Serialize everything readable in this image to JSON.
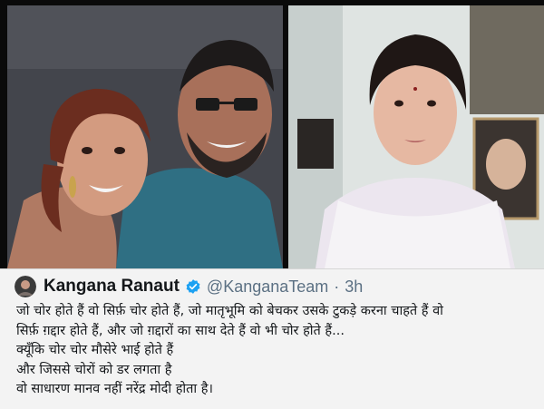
{
  "photos": {
    "left": {
      "icon": "photo-two-people"
    },
    "right": {
      "icon": "photo-woman-video"
    }
  },
  "tweet": {
    "author_name": "Kangana Ranaut",
    "verified_icon": "verified-badge-icon",
    "handle": "@KanganaTeam",
    "separator": "·",
    "time": "3h",
    "lines": [
      "जो चोर होते हैं वो सिर्फ़ चोर होते हैं, जो मातृभूमि को बेचकर उसके टुकड़े करना चाहते हैं वो",
      "सिर्फ़ ग़द्दार होते हैं, और जो ग़द्दारों का साथ देते हैं वो भी चोर होते हैं...",
      "क्यूँकि चोर चोर मौसेरे भाई होते हैं",
      "और जिससे चोरों को डर लगता है",
      "वो साधारण मानव नहीं नरेंद्र मोदी होता है।"
    ],
    "colors": {
      "background": "#f3f3f3",
      "text": "#14171a",
      "muted": "#5b7083",
      "verified": "#1da1f2"
    }
  }
}
